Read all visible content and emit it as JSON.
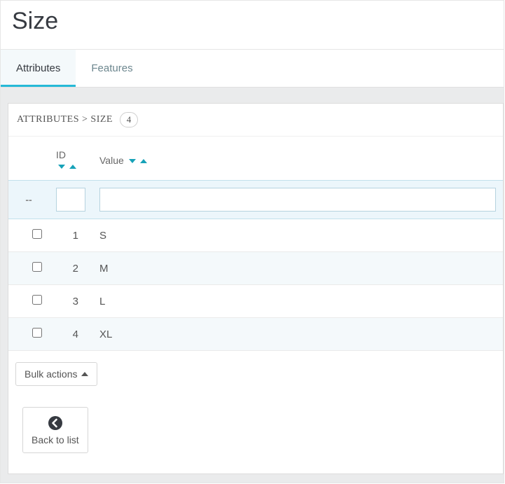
{
  "page": {
    "title": "Size"
  },
  "tabs": {
    "attributes": "Attributes",
    "features": "Features"
  },
  "heading": {
    "breadcrumb_parent": "ATTRIBUTES",
    "breadcrumb_sep": ">",
    "breadcrumb_current": "SIZE",
    "count": "4"
  },
  "columns": {
    "id": "ID",
    "value": "Value"
  },
  "filter": {
    "chk_placeholder": "--"
  },
  "rows": [
    {
      "id": "1",
      "value": "S"
    },
    {
      "id": "2",
      "value": "M"
    },
    {
      "id": "3",
      "value": "L"
    },
    {
      "id": "4",
      "value": "XL"
    }
  ],
  "buttons": {
    "bulk": "Bulk actions",
    "back": "Back to list"
  }
}
